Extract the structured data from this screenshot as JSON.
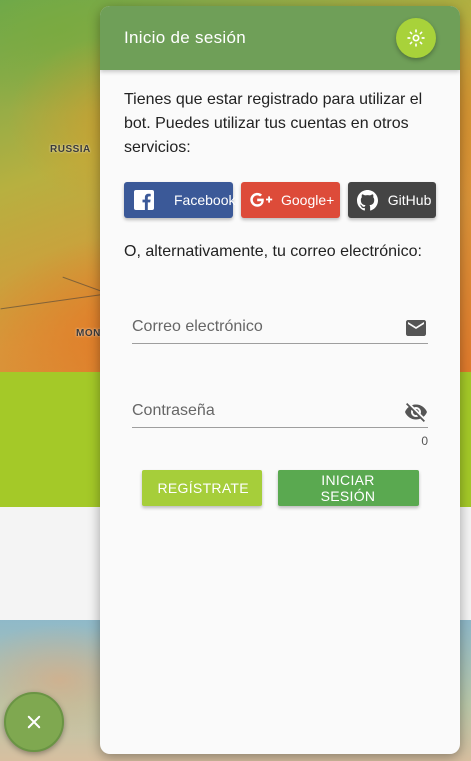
{
  "map": {
    "labels": [
      "RUSSIA",
      "MON"
    ]
  },
  "close_fab": {
    "icon": "close-icon"
  },
  "login_card": {
    "title": "Inicio de sesión",
    "theme_icon": "brightness-icon",
    "intro": "Tienes que estar registrado para utilizar el bot. Puedes utilizar tus cuentas en otros servicios:",
    "social": [
      {
        "label": "Facebook",
        "icon": "facebook-icon",
        "color": "#3b5998"
      },
      {
        "label": "Google+",
        "icon": "google-plus-icon",
        "color": "#dd4b39"
      },
      {
        "label": "GitHub",
        "icon": "github-icon",
        "color": "#444444"
      }
    ],
    "alt_text": "O, alternativamente, tu correo electrónico:",
    "email": {
      "placeholder": "Correo electrónico",
      "value": "",
      "icon": "mail-icon"
    },
    "password": {
      "placeholder": "Contraseña",
      "value": "",
      "icon": "visibility-off-icon",
      "counter": "0"
    },
    "actions": {
      "register": "REGÍSTRATE",
      "login": "INICIAR SESIÓN"
    }
  },
  "colors": {
    "header": "#6f9f58",
    "accent": "#a8d23a",
    "register": "#a6ce3a",
    "login": "#5aa950",
    "band_green": "#a4c928"
  }
}
